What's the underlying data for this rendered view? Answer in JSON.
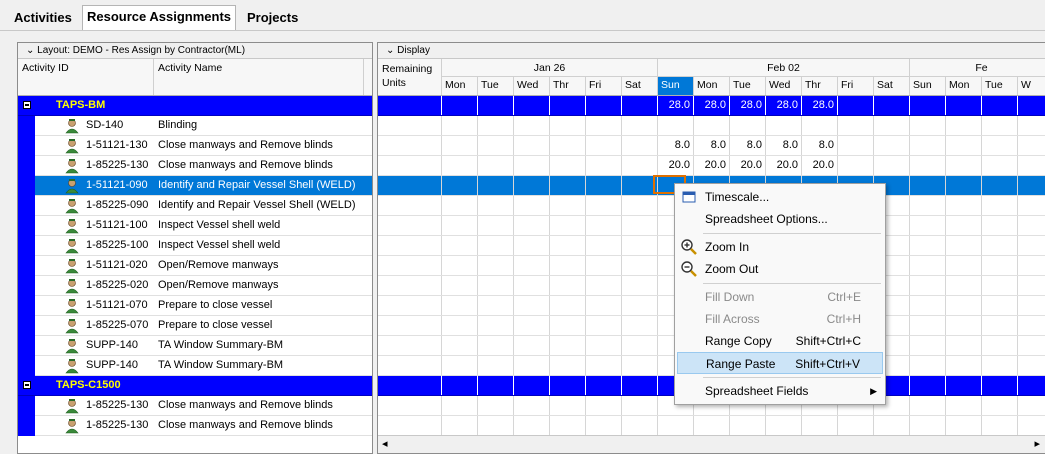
{
  "tabs": [
    "Activities",
    "Resource Assignments",
    "Projects"
  ],
  "left_pane": {
    "layout_label": "Layout: DEMO - Res Assign by Contractor(ML)",
    "col_activity_id": "Activity ID",
    "col_activity_name": "Activity Name"
  },
  "right_pane": {
    "display_label": "Display",
    "col_remaining": "Remaining Units",
    "weeks": [
      "Jan 26",
      "Feb 02",
      "Fe"
    ],
    "days": [
      "Mon",
      "Tue",
      "Wed",
      "Thr",
      "Fri",
      "Sat",
      "Sun",
      "Mon",
      "Tue",
      "Wed",
      "Thr",
      "Fri",
      "Sat",
      "Sun",
      "Mon",
      "Tue",
      "W"
    ]
  },
  "rows": [
    {
      "type": "group",
      "title": "TAPS-BM",
      "values": [
        "",
        "",
        "",
        "",
        "",
        "",
        "28.0",
        "28.0",
        "28.0",
        "28.0",
        "28.0",
        "",
        "",
        "",
        "",
        "",
        ""
      ]
    },
    {
      "type": "item",
      "id": "SD-140",
      "name": "Blinding",
      "values": []
    },
    {
      "type": "item",
      "id": "1-51121-130",
      "name": "Close manways and Remove blinds",
      "values": [
        "",
        "",
        "",
        "",
        "",
        "",
        "8.0",
        "8.0",
        "8.0",
        "8.0",
        "8.0"
      ]
    },
    {
      "type": "item",
      "id": "1-85225-130",
      "name": "Close manways and Remove blinds",
      "values": [
        "",
        "",
        "",
        "",
        "",
        "",
        "20.0",
        "20.0",
        "20.0",
        "20.0",
        "20.0"
      ]
    },
    {
      "type": "item",
      "id": "1-51121-090",
      "name": "Identify and Repair Vessel Shell (WELD)",
      "selected": true,
      "values": []
    },
    {
      "type": "item",
      "id": "1-85225-090",
      "name": "Identify and Repair Vessel Shell (WELD)",
      "values": []
    },
    {
      "type": "item",
      "id": "1-51121-100",
      "name": "Inspect Vessel shell weld",
      "values": []
    },
    {
      "type": "item",
      "id": "1-85225-100",
      "name": "Inspect Vessel shell weld",
      "values": []
    },
    {
      "type": "item",
      "id": "1-51121-020",
      "name": "Open/Remove manways",
      "values": []
    },
    {
      "type": "item",
      "id": "1-85225-020",
      "name": "Open/Remove manways",
      "values": []
    },
    {
      "type": "item",
      "id": "1-51121-070",
      "name": "Prepare to close vessel",
      "values": []
    },
    {
      "type": "item",
      "id": "1-85225-070",
      "name": "Prepare to close vessel",
      "values": []
    },
    {
      "type": "item",
      "id": "SUPP-140",
      "name": "TA Window Summary-BM",
      "values": []
    },
    {
      "type": "item",
      "id": "SUPP-140",
      "name": "TA Window Summary-BM",
      "values": []
    },
    {
      "type": "group",
      "title": "TAPS-C1500",
      "values": []
    },
    {
      "type": "item",
      "id": "1-85225-130",
      "name": "Close manways and Remove blinds",
      "values": []
    },
    {
      "type": "item",
      "id": "1-85225-130",
      "name": "Close manways and Remove blinds",
      "values": []
    }
  ],
  "context_menu": {
    "timescale": "Timescale...",
    "spreadsheet_options": "Spreadsheet Options...",
    "zoom_in": "Zoom In",
    "zoom_out": "Zoom Out",
    "fill_down": "Fill Down",
    "fill_down_sc": "Ctrl+E",
    "fill_across": "Fill Across",
    "fill_across_sc": "Ctrl+H",
    "range_copy": "Range Copy",
    "range_copy_sc": "Shift+Ctrl+C",
    "range_paste": "Range Paste",
    "range_paste_sc": "Shift+Ctrl+V",
    "spreadsheet_fields": "Spreadsheet Fields"
  },
  "colors": {
    "group_bg": "#0000ff",
    "group_text": "#ffff00",
    "selected_bg": "#0078d7",
    "today_col": "#0078d7",
    "menu_highlight": "#cce4f7"
  }
}
